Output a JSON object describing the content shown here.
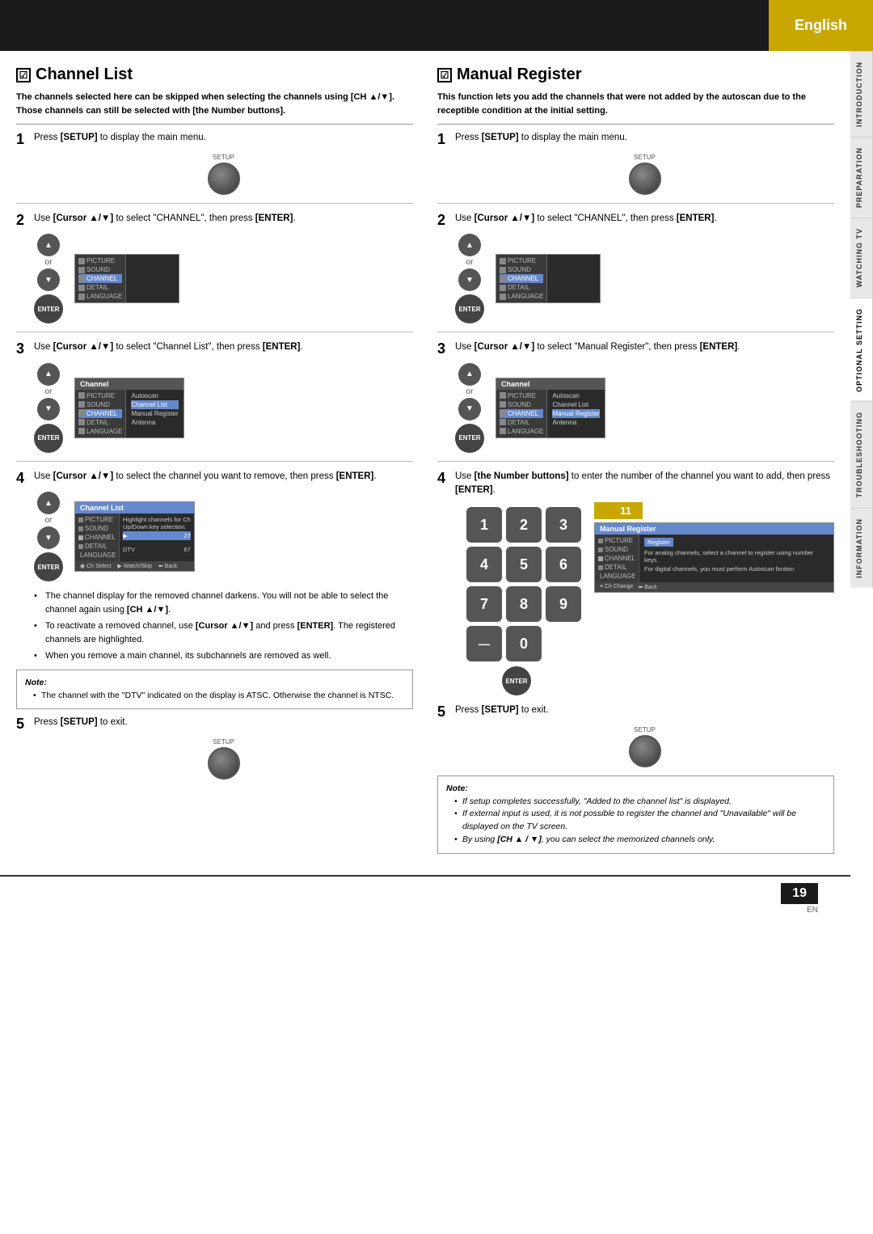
{
  "header": {
    "language": "English",
    "background": "#1a1a1a",
    "badge_color": "#c8a800"
  },
  "side_tabs": [
    {
      "label": "INTRODUCTION",
      "active": false
    },
    {
      "label": "PREPARATION",
      "active": false
    },
    {
      "label": "WATCHING TV",
      "active": false
    },
    {
      "label": "OPTIONAL SETTING",
      "active": true
    },
    {
      "label": "TROUBLESHOOTING",
      "active": false
    },
    {
      "label": "INFORMATION",
      "active": false
    }
  ],
  "channel_list": {
    "title": "Channel List",
    "checkbox": "☑",
    "desc1": "The channels selected here can be skipped when selecting the channels using [CH ▲/▼].",
    "desc2": "Those channels can still be selected with [the Number buttons].",
    "steps": [
      {
        "num": "1",
        "text": "Press [SETUP] to display the main menu.",
        "setup_label": "SETUP"
      },
      {
        "num": "2",
        "text": "Use [Cursor ▲/▼] to select \"CHANNEL\", then press [ENTER]."
      },
      {
        "num": "3",
        "text": "Use [Cursor ▲/▼] to select \"Channel List\", then press [ENTER].",
        "menu_channel_items": [
          "Autoscan",
          "Channel List",
          "Manual Register",
          "Antenna"
        ],
        "menu_channel_selected": "Channel List"
      },
      {
        "num": "4",
        "text": "Use [Cursor ▲/▼] to select the channel you want to remove, then press [ENTER].",
        "channel_list_rows": [
          {
            "name": "",
            "num": "27",
            "skip": false
          },
          {
            "name": "",
            "num": "",
            "skip": true
          },
          {
            "name": "",
            "num": "",
            "skip": false
          },
          {
            "name": "",
            "num": "",
            "skip": false
          },
          {
            "name": "DTV",
            "num": "67",
            "skip": false
          }
        ]
      }
    ],
    "bullets": [
      "The channel display for the removed channel darkens. You will not be able to select the channel again using [CH ▲/▼].",
      "To reactivate a removed channel, use [Cursor ▲/▼] and press [ENTER]. The registered channels are highlighted.",
      "When you remove a main channel, its subchannels are removed as well."
    ],
    "note": {
      "title": "Note:",
      "items": [
        "The channel with the \"DTV\" indicated on the display is ATSC. Otherwise the channel is NTSC."
      ]
    },
    "step5": {
      "num": "5",
      "text": "Press [SETUP] to exit.",
      "setup_label": "SETUP"
    }
  },
  "manual_register": {
    "title": "Manual Register",
    "checkbox": "☑",
    "desc1": "This function lets you add the channels that were not added by the autoscan due to the receptible condition at the initial setting.",
    "steps": [
      {
        "num": "1",
        "text": "Press [SETUP] to display the main menu.",
        "setup_label": "SETUP"
      },
      {
        "num": "2",
        "text": "Use [Cursor ▲/▼] to select \"CHANNEL\", then press [ENTER]."
      },
      {
        "num": "3",
        "text": "Use [Cursor ▲/▼] to select \"Manual Register\", then press [ENTER].",
        "menu_channel_items": [
          "Autoscan",
          "Channel List",
          "Manual Register",
          "Antenna"
        ],
        "menu_channel_selected": "Manual Register"
      },
      {
        "num": "4",
        "text": "Use [the Number buttons] to enter the number of the channel you want to add, then press [ENTER].",
        "numpad": [
          "1",
          "2",
          "3",
          "4",
          "5",
          "6",
          "7",
          "8",
          "9",
          "—",
          "0"
        ],
        "channel_display": "11"
      }
    ],
    "step5": {
      "num": "5",
      "text": "Press [SETUP] to exit.",
      "setup_label": "SETUP"
    },
    "note": {
      "title": "Note:",
      "items": [
        "If setup completes successfully, \"Added to the channel list\" is displayed.",
        "If external input is used, it is not possible to register the channel and \"Unavailable\" will be displayed on the TV screen.",
        "By using [CH ▲ / ▼], you can select the memorized channels only."
      ]
    }
  },
  "footer": {
    "page_number": "19",
    "page_label": "EN"
  },
  "menu_sidebar_items": [
    {
      "icon": "pic",
      "label": "PICTURE"
    },
    {
      "icon": "snd",
      "label": "SOUND"
    },
    {
      "icon": "ch",
      "label": "CHANNEL"
    },
    {
      "icon": "det",
      "label": "DETAIL"
    },
    {
      "icon": "lang",
      "label": "LANGUAGE"
    }
  ]
}
